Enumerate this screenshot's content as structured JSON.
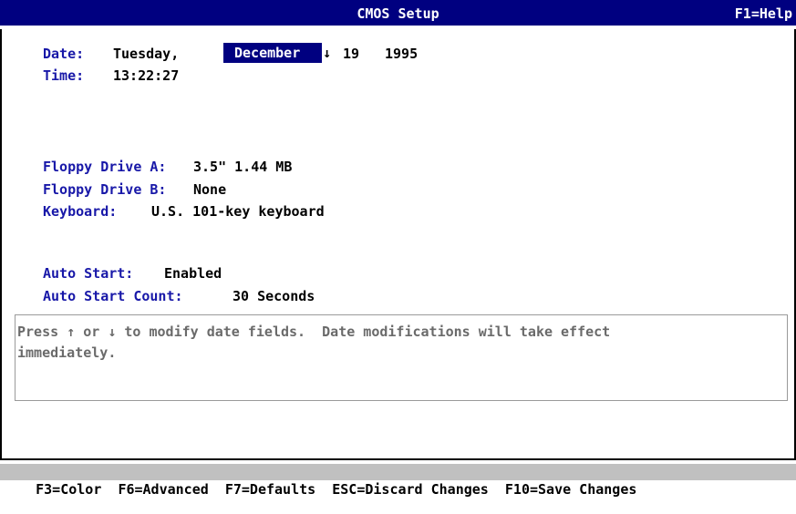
{
  "titlebar": {
    "title": "CMOS Setup",
    "help": "F1=Help"
  },
  "date": {
    "label": "Date:",
    "weekday": "Tuesday,",
    "month": "December",
    "day": "19",
    "year": "1995"
  },
  "time": {
    "label": "Time:",
    "value": "13:22:27"
  },
  "floppy_a": {
    "label": "Floppy Drive A:",
    "value": "3.5\" 1.44 MB"
  },
  "floppy_b": {
    "label": "Floppy Drive B:",
    "value": "None"
  },
  "keyboard": {
    "label": "Keyboard:",
    "value": "U.S. 101-key keyboard"
  },
  "auto_start": {
    "label": "Auto Start:",
    "value": "Enabled"
  },
  "auto_start_count": {
    "label": "Auto Start Count:",
    "value": "30 Seconds"
  },
  "message": {
    "line1": "Press ↑ or ↓ to modify date fields.  Date modifications will take effect",
    "line2": "immediately."
  },
  "statusbar": {
    "items": [
      "F3=Color",
      "F6=Advanced",
      "F7=Defaults",
      "ESC=Discard Changes",
      "F10=Save Changes"
    ]
  },
  "icons": {
    "dropdown": "down-arrow-icon"
  },
  "colors": {
    "titlebar": "#000080",
    "labels": "#1818a8",
    "selection": "#000080",
    "statusbar": "#c0c0c0"
  }
}
